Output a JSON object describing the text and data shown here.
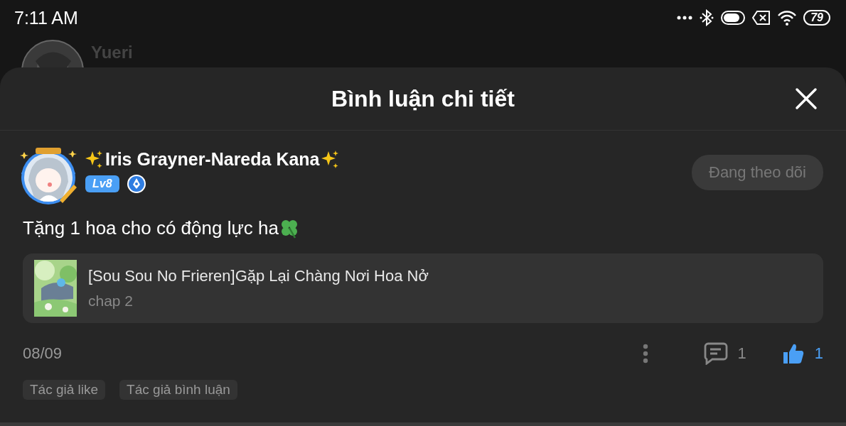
{
  "status_bar": {
    "time": "7:11  AM",
    "battery": "79"
  },
  "background": {
    "user_name": "Yueri"
  },
  "sheet": {
    "title": "Bình luận chi tiết"
  },
  "comment": {
    "author": "Iris Grayner-Nareda Kana",
    "level": "Lv8",
    "following": true,
    "follow_label": "Đang theo dõi",
    "text": "Tặng 1 hoa cho có động lực ha",
    "story": {
      "title": "[Sou Sou No Frieren]Gặp Lại Chàng Nơi Hoa Nở",
      "chapter": "chap 2"
    },
    "date": "08/09",
    "reply_count": "1",
    "liked": true,
    "like_count": "1",
    "tags": [
      "Tác giả like",
      "Tác giả bình luận"
    ]
  }
}
